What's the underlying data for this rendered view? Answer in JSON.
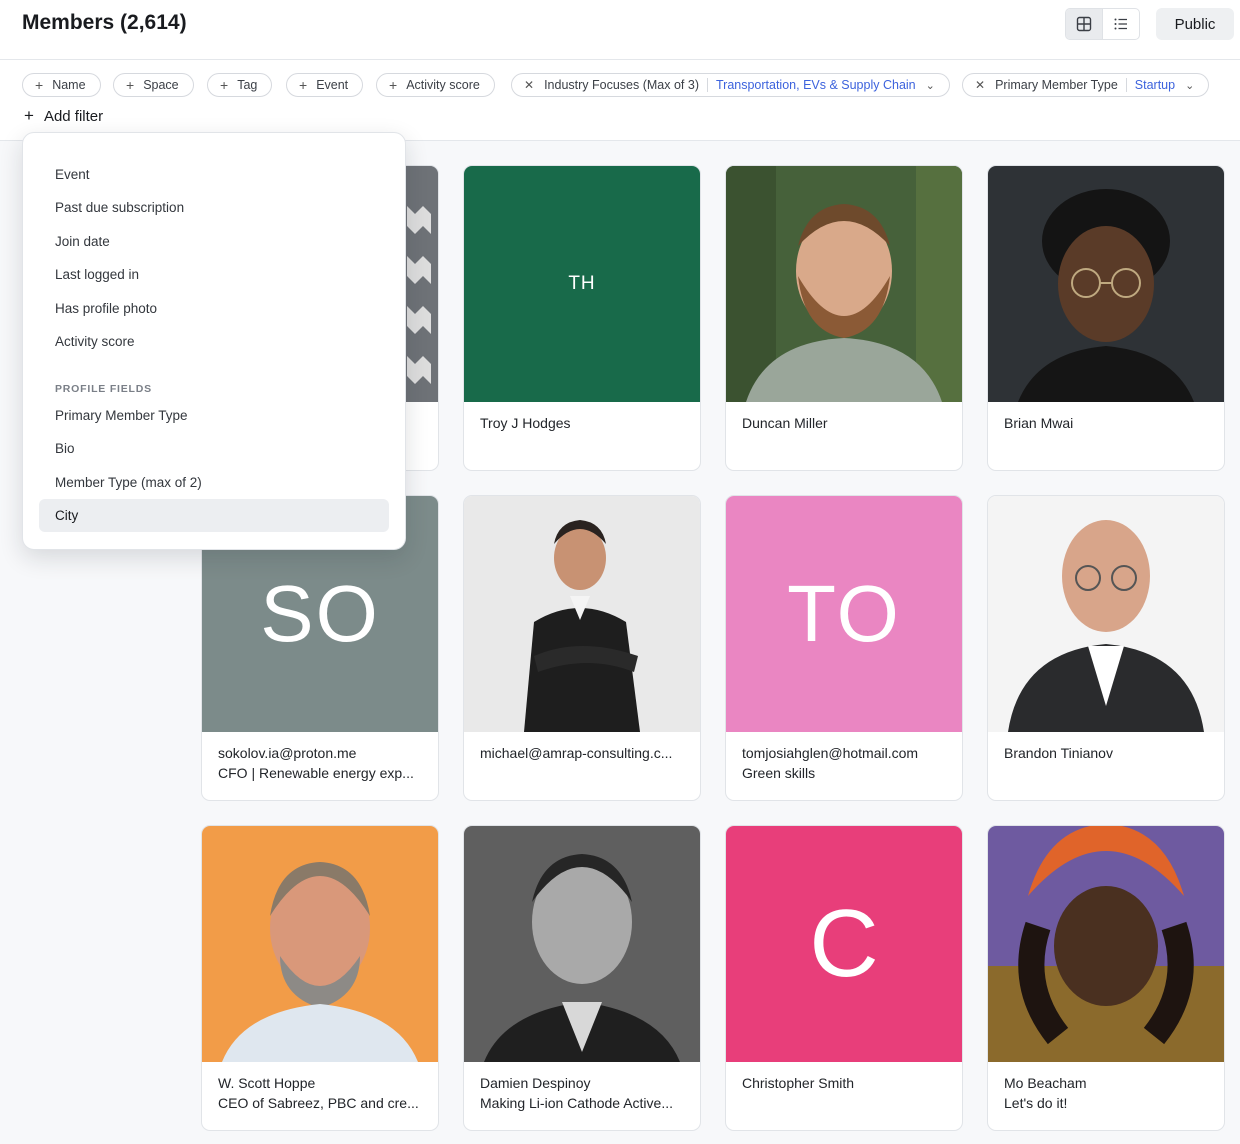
{
  "header": {
    "title": "Members (2,614)",
    "public_label": "Public",
    "views": [
      {
        "icon": "grid-view-icon",
        "active": true
      },
      {
        "icon": "list-view-icon",
        "active": false
      }
    ]
  },
  "filters": {
    "add_chips": [
      "Name",
      "Space",
      "Tag",
      "Event",
      "Activity score"
    ],
    "active_chips": [
      {
        "label": "Industry Focuses (Max of 3)",
        "value": "Transportation, EVs & Supply Chain"
      },
      {
        "label": "Primary Member Type",
        "value": "Startup"
      }
    ],
    "add_filter_label": "Add filter"
  },
  "dropdown": {
    "items": [
      "Event",
      "Past due subscription",
      "Join date",
      "Last logged in",
      "Has profile photo",
      "Activity score"
    ],
    "section_label": "PROFILE FIELDS",
    "profile_items": [
      "Primary Member Type",
      "Bio",
      "Member Type (max of 2)",
      "City"
    ],
    "hovered_item": "City"
  },
  "members": [
    {
      "name": "",
      "subtitle": "",
      "avatar": "photo",
      "color": "#9aa0a6"
    },
    {
      "name": "Troy J Hodges",
      "subtitle": "",
      "avatar": "initials",
      "initials": "TH",
      "color": "#186a4a"
    },
    {
      "name": "Duncan Miller",
      "subtitle": "",
      "avatar": "photo",
      "color": "#4f6b3a"
    },
    {
      "name": "Brian Mwai",
      "subtitle": "",
      "avatar": "photo",
      "color": "#2c3034"
    },
    {
      "name": "sokolov.ia@proton.me",
      "subtitle": "CFO | Renewable energy exp...",
      "avatar": "initials",
      "initials": "SO",
      "color": "#7c8b8a"
    },
    {
      "name": "michael@amrap-consulting.c...",
      "subtitle": "",
      "avatar": "photo",
      "color": "#e7e7e7"
    },
    {
      "name": "tomjosiahglen@hotmail.com",
      "subtitle": "Green skills",
      "avatar": "initials",
      "initials": "TO",
      "color": "#ea86c2"
    },
    {
      "name": "Brandon Tinianov",
      "subtitle": "",
      "avatar": "photo",
      "color": "#f3f3f3"
    },
    {
      "name": "W. Scott Hoppe",
      "subtitle": "CEO of Sabreez, PBC and cre...",
      "avatar": "photo",
      "color": "#f19a4a"
    },
    {
      "name": "Damien Despinoy",
      "subtitle": "Making Li-ion Cathode Active...",
      "avatar": "photo",
      "color": "#6e6e6e"
    },
    {
      "name": "Christopher Smith",
      "subtitle": "",
      "avatar": "initials",
      "initials": "C",
      "color": "#e83e7a"
    },
    {
      "name": "Mo Beacham",
      "subtitle": "Let's do it!",
      "avatar": "photo",
      "color": "#8b6a2c"
    }
  ]
}
